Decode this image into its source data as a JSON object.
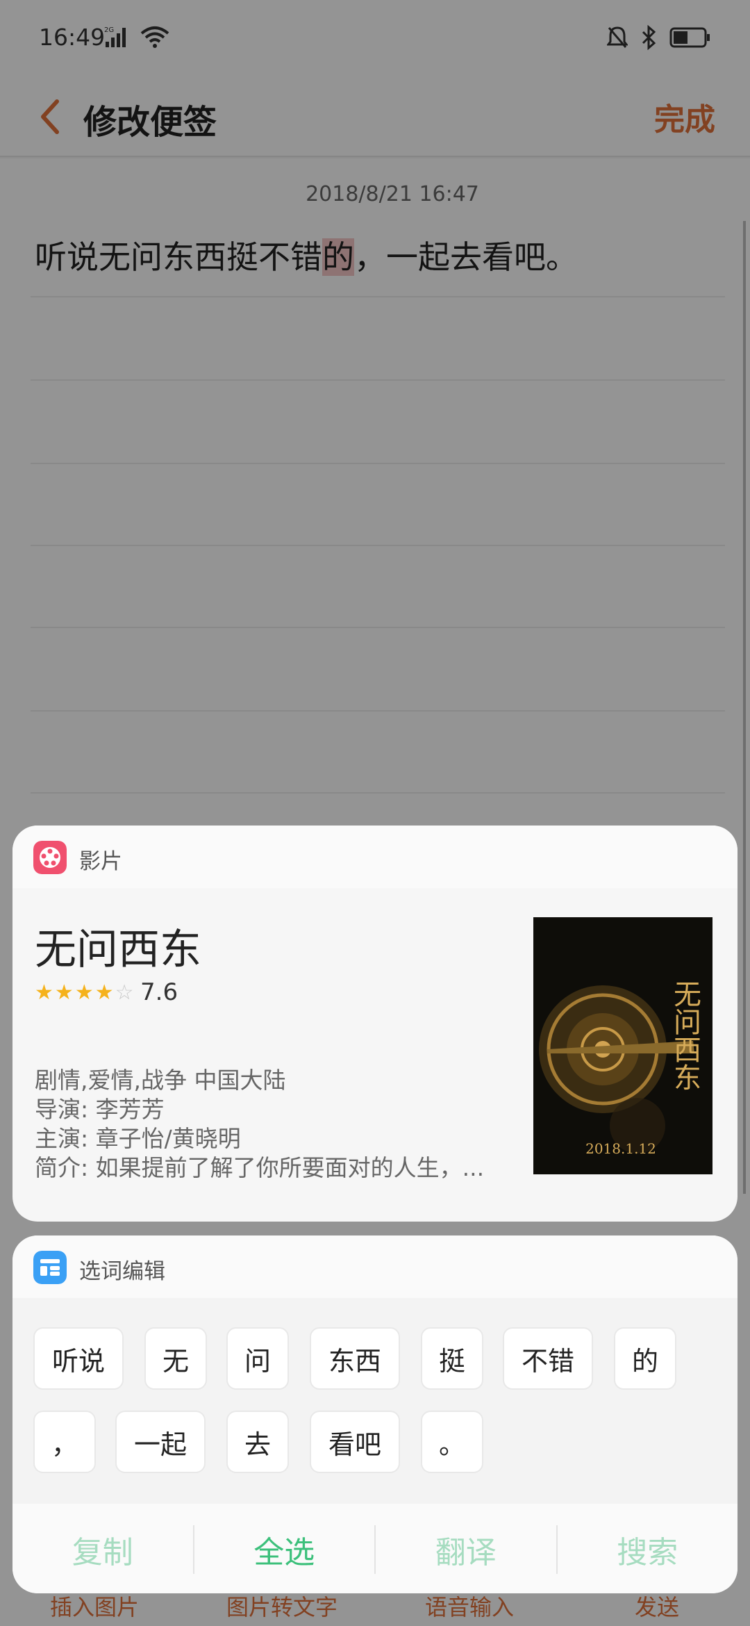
{
  "status_bar": {
    "time": "16:49",
    "net_label": "2G"
  },
  "header": {
    "title": "修改便签",
    "done_label": "完成"
  },
  "note": {
    "date": "2018/8/21 16:47",
    "text_before": "听说无问东西挺不错",
    "text_highlight": "的",
    "text_after": "，一起去看吧。"
  },
  "bottom_toolbar": {
    "items": [
      "插入图片",
      "图片转文字",
      "语音输入",
      "发送"
    ]
  },
  "movie_card": {
    "header_title": "影片",
    "title": "无问西东",
    "rating": "7.6",
    "stars": 4,
    "genre_region": "剧情,爱情,战争 中国大陆",
    "director": "导演: 李芳芳",
    "cast": "主演: 章子怡/黄晓明",
    "synopsis": "简介: 如果提前了解了你所要面对的人生，...",
    "poster": {
      "title_vertical": "无问西东",
      "release_date": "2018.1.12"
    }
  },
  "word_edit": {
    "header_title": "选词编辑",
    "words": [
      "听说",
      "无",
      "问",
      "东西",
      "挺",
      "不错",
      "的",
      "，",
      "一起",
      "去",
      "看吧",
      "。"
    ],
    "actions": [
      "复制",
      "全选",
      "翻译",
      "搜索"
    ],
    "active_action": "全选"
  },
  "colors": {
    "accent_orange": "#e0703a",
    "action_green": "#3cc07b",
    "action_green_disabled": "#a6dcc0",
    "star_gold": "#f5b21c"
  }
}
